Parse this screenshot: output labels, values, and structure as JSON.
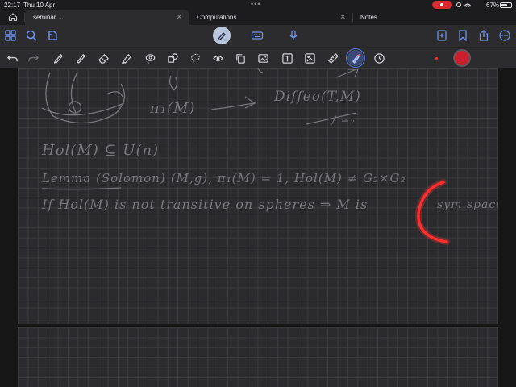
{
  "status": {
    "time": "22:17",
    "date": "Thu 10 Apr",
    "dots": "•••",
    "battery": "67%",
    "battery_level": 0.67
  },
  "tabs": [
    {
      "label": "seminar",
      "active": true
    },
    {
      "label": "Computations",
      "active": false
    },
    {
      "label": "Notes",
      "active": false
    }
  ],
  "toolbar": {
    "left": [
      "grid-icon",
      "search-icon",
      "bookmark-export-icon"
    ],
    "center": [
      "pen-mode-icon",
      "keyboard-icon",
      "microphone-icon"
    ],
    "right": [
      "add-page-icon",
      "bookmark-icon",
      "share-icon",
      "more-icon"
    ]
  },
  "tools": [
    "undo-icon",
    "redo-icon",
    "pen-icon",
    "pencil-icon",
    "eraser-icon",
    "highlighter-icon",
    "lasso-icon",
    "shapes-icon",
    "lasso-free-icon",
    "sticker-icon",
    "copy-icon",
    "image-icon",
    "text-icon",
    "image-crop-icon",
    "ruler-icon",
    "laser-pointer-icon",
    "timer-icon"
  ],
  "colors": {
    "accent": "#5a78d8",
    "ink": "#77777c",
    "red_ink": "#ff2d2d",
    "selected_color": "#cc1f2e"
  },
  "note": {
    "line1": "π₁(M)",
    "line1b": "Diffeo(T,M)",
    "line1c": "/ ≃ᵧ",
    "line2": "Hol(M) ⊆ U(n)",
    "line3_lemma": "Lemma (Solomon)",
    "line3_rest": ": (M,g), π₁(M) = 1, Hol(M) ≠ G₂×G₂",
    "line4": "If Hol(M) is not transitive on spheres ⇒ M is",
    "line4_end": "sym.space"
  }
}
